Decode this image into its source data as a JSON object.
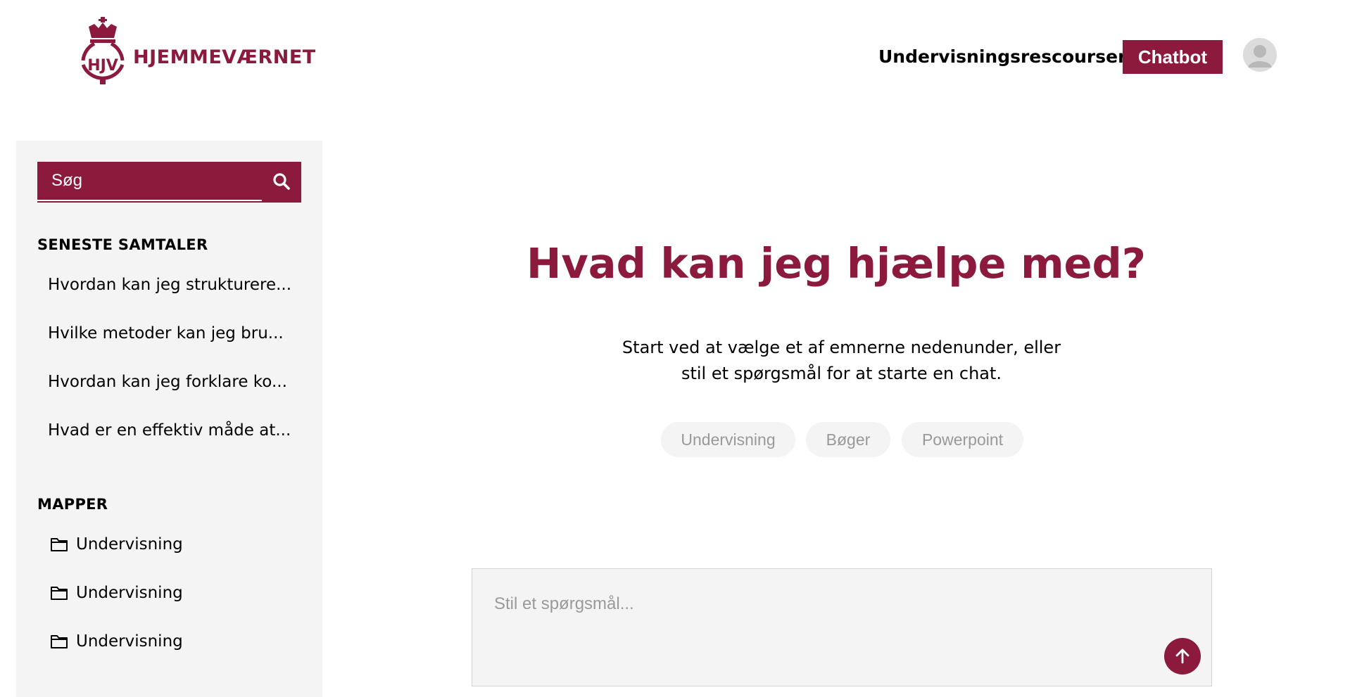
{
  "header": {
    "logo_text": "HJEMMEVÆRNET",
    "logo_emblem_text": "HJV",
    "nav_link": "Undervisningsrescourser",
    "chatbot_button": "Chatbot"
  },
  "sidebar": {
    "search": {
      "placeholder": "Søg"
    },
    "recent_title": "SENESTE SAMTALER",
    "recent": [
      "Hvordan kan jeg strukturere...",
      "Hvilke metoder kan jeg bru...",
      "Hvordan kan jeg forklare ko...",
      "Hvad er en effektiv måde at..."
    ],
    "folders_title": "MAPPER",
    "folders": [
      "Undervisning",
      "Undervisning",
      "Undervisning"
    ]
  },
  "main": {
    "headline": "Hvad kan jeg hjælpe med?",
    "subtext_line1": "Start ved at vælge et af emnerne nedenunder, eller",
    "subtext_line2": "stil et spørgsmål for at starte en chat.",
    "chips": [
      "Undervisning",
      "Bøger",
      "Powerpoint"
    ],
    "input_placeholder": "Stil et spørgsmål..."
  },
  "colors": {
    "brand": "#8b1a3d",
    "sidebar_bg": "#f4f4f4",
    "chip_text": "#999999"
  },
  "icons": {
    "logo": "hjv-crown-emblem-icon",
    "search": "search-icon",
    "avatar": "user-avatar-icon",
    "folder": "folder-icon",
    "send": "arrow-up-icon"
  }
}
